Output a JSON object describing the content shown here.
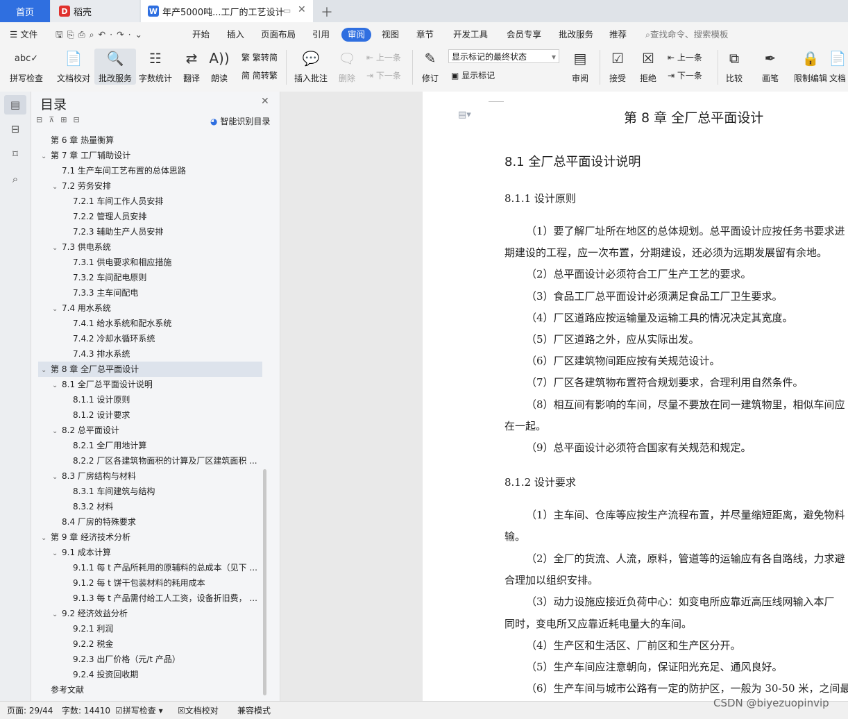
{
  "tabs": {
    "home": "首页",
    "daoke": "稻壳",
    "doc": "年产5000吨...工厂的工艺设计"
  },
  "menu": {
    "file": "文件",
    "items": [
      "开始",
      "插入",
      "页面布局",
      "引用",
      "审阅",
      "视图",
      "章节",
      "开发工具",
      "会员专享",
      "批改服务",
      "推荐"
    ],
    "search": "查找命令、搜索模板"
  },
  "ribbon": {
    "spell": "拼写检查",
    "proof": "文档校对",
    "correct": "批改服务",
    "count": "字数统计",
    "translate": "翻译",
    "read": "朗读",
    "to_trad": "繁转简",
    "to_simp": "简转繁",
    "insert_comment": "插入批注",
    "delete": "删除",
    "prev": "上一条",
    "next": "下一条",
    "track": "修订",
    "markup_select": "显示标记的最终状态",
    "show_markup": "显示标记",
    "review": "审阅",
    "accept": "接受",
    "reject": "拒绝",
    "prev2": "上一条",
    "next2": "下一条",
    "compare": "比较",
    "pen": "画笔",
    "restrict": "限制编辑",
    "doc_more": "文档"
  },
  "toc": {
    "title": "目录",
    "smart": "智能识别目录",
    "items": [
      {
        "text": "第 6 章  热量衡算",
        "level": 1,
        "chev": ""
      },
      {
        "text": "第 7 章  工厂辅助设计",
        "level": 1,
        "chev": "v"
      },
      {
        "text": "7.1  生产车间工艺布置的总体思路",
        "level": 2,
        "chev": ""
      },
      {
        "text": "7.2  劳务安排",
        "level": 2,
        "chev": "v"
      },
      {
        "text": "7.2.1  车间工作人员安排",
        "level": 3,
        "chev": ""
      },
      {
        "text": "7.2.2  管理人员安排",
        "level": 3,
        "chev": ""
      },
      {
        "text": "7.2.3  辅助生产人员安排",
        "level": 3,
        "chev": ""
      },
      {
        "text": "7.3  供电系统",
        "level": 2,
        "chev": "v"
      },
      {
        "text": "7.3.1  供电要求和相应措施",
        "level": 3,
        "chev": ""
      },
      {
        "text": "7.3.2  车间配电原则",
        "level": 3,
        "chev": ""
      },
      {
        "text": "7.3.3  主车间配电",
        "level": 3,
        "chev": ""
      },
      {
        "text": "7.4  用水系统",
        "level": 2,
        "chev": "v"
      },
      {
        "text": "7.4.1  给水系统和配水系统",
        "level": 3,
        "chev": ""
      },
      {
        "text": "7.4.2  冷却水循环系统",
        "level": 3,
        "chev": ""
      },
      {
        "text": "7.4.3  排水系统",
        "level": 3,
        "chev": ""
      },
      {
        "text": "第 8 章  全厂总平面设计",
        "level": 1,
        "chev": "v",
        "selected": true
      },
      {
        "text": "8.1  全厂总平面设计说明",
        "level": 2,
        "chev": "v"
      },
      {
        "text": "8.1.1  设计原则",
        "level": 3,
        "chev": ""
      },
      {
        "text": "8.1.2  设计要求",
        "level": 3,
        "chev": ""
      },
      {
        "text": "8.2  总平面设计",
        "level": 2,
        "chev": "v"
      },
      {
        "text": "8.2.1  全厂用地计算",
        "level": 3,
        "chev": ""
      },
      {
        "text": "8.2.2  厂区各建筑物面积的计算及厂区建筑面积 ...",
        "level": 3,
        "chev": ""
      },
      {
        "text": "8.3  厂房结构与材料",
        "level": 2,
        "chev": "v"
      },
      {
        "text": "8.3.1  车间建筑与结构",
        "level": 3,
        "chev": ""
      },
      {
        "text": "8.3.2  材料",
        "level": 3,
        "chev": ""
      },
      {
        "text": "8.4  厂房的特殊要求",
        "level": 2,
        "chev": ""
      },
      {
        "text": "第 9 章  经济技术分析",
        "level": 1,
        "chev": "v"
      },
      {
        "text": "9.1  成本计算",
        "level": 2,
        "chev": "v"
      },
      {
        "text": "9.1.1  每 t 产品所耗用的原辅料的总成本（见下 ...",
        "level": 3,
        "chev": ""
      },
      {
        "text": "9.1.2  每 t 饼干包装材料的耗用成本",
        "level": 3,
        "chev": ""
      },
      {
        "text": "9.1.3 每 t 产品需付给工人工资，设备折旧费，  ...",
        "level": 3,
        "chev": ""
      },
      {
        "text": "9.2  经济效益分析",
        "level": 2,
        "chev": "v"
      },
      {
        "text": "9.2.1  利润",
        "level": 3,
        "chev": ""
      },
      {
        "text": "9.2.2  税金",
        "level": 3,
        "chev": ""
      },
      {
        "text": "9.2.3  出厂价格（元/t 产品）",
        "level": 3,
        "chev": ""
      },
      {
        "text": "9.2.4  投资回收期",
        "level": 3,
        "chev": ""
      },
      {
        "text": "参考文献",
        "level": 1,
        "chev": ""
      }
    ]
  },
  "doc": {
    "chapter": "第 8 章  全厂总平面设计",
    "h2": "8.1  全厂总平面设计说明",
    "h3a": "8.1.1  设计原则",
    "h3b": "8.1.2  设计要求",
    "lines_a": [
      "（1）要了解厂址所在地区的总体规划。总平面设计应按任务书要求进",
      "期建设的工程，应一次布置，分期建设，还必须为远期发展留有余地。",
      "（2）总平面设计必须符合工厂生产工艺的要求。",
      "（3）食品工厂总平面设计必须满足食品工厂卫生要求。",
      "（4）厂区道路应按运输量及运输工具的情况决定其宽度。",
      "（5）厂区道路之外，应从实际出发。",
      "（6）厂区建筑物间距应按有关规范设计。",
      "（7）厂区各建筑物布置符合规划要求，合理利用自然条件。",
      "（8）相互间有影响的车间，尽量不要放在同一建筑物里，相似车间应",
      "在一起。",
      "（9）总平面设计必须符合国家有关规范和规定。"
    ],
    "lines_b": [
      "（1）主车间、仓库等应按生产流程布置，并尽量缩短距离，避免物料",
      "输。",
      "（2）全厂的货流、人流，原料，管道等的运输应有各自路线，力求避",
      "合理加以组织安排。",
      "（3）动力设施应接近负荷中心：如变电所应靠近高压线网输入本厂",
      "同时，变电所又应靠近耗电量大的车间。",
      "（4）生产区和生活区、厂前区和生产区分开。",
      "（5）生产车间应注意朝向，保证阳光充足、通风良好。",
      "（6）生产车间与城市公路有一定的防护区，一般为 30-50 米，之间最"
    ]
  },
  "status": {
    "page": "页面: 29/44",
    "words": "字数: 14410",
    "spell": "拼写检查",
    "proof": "文档校对",
    "compat": "兼容模式",
    "watermark": "CSDN @biyezuopinvip"
  }
}
